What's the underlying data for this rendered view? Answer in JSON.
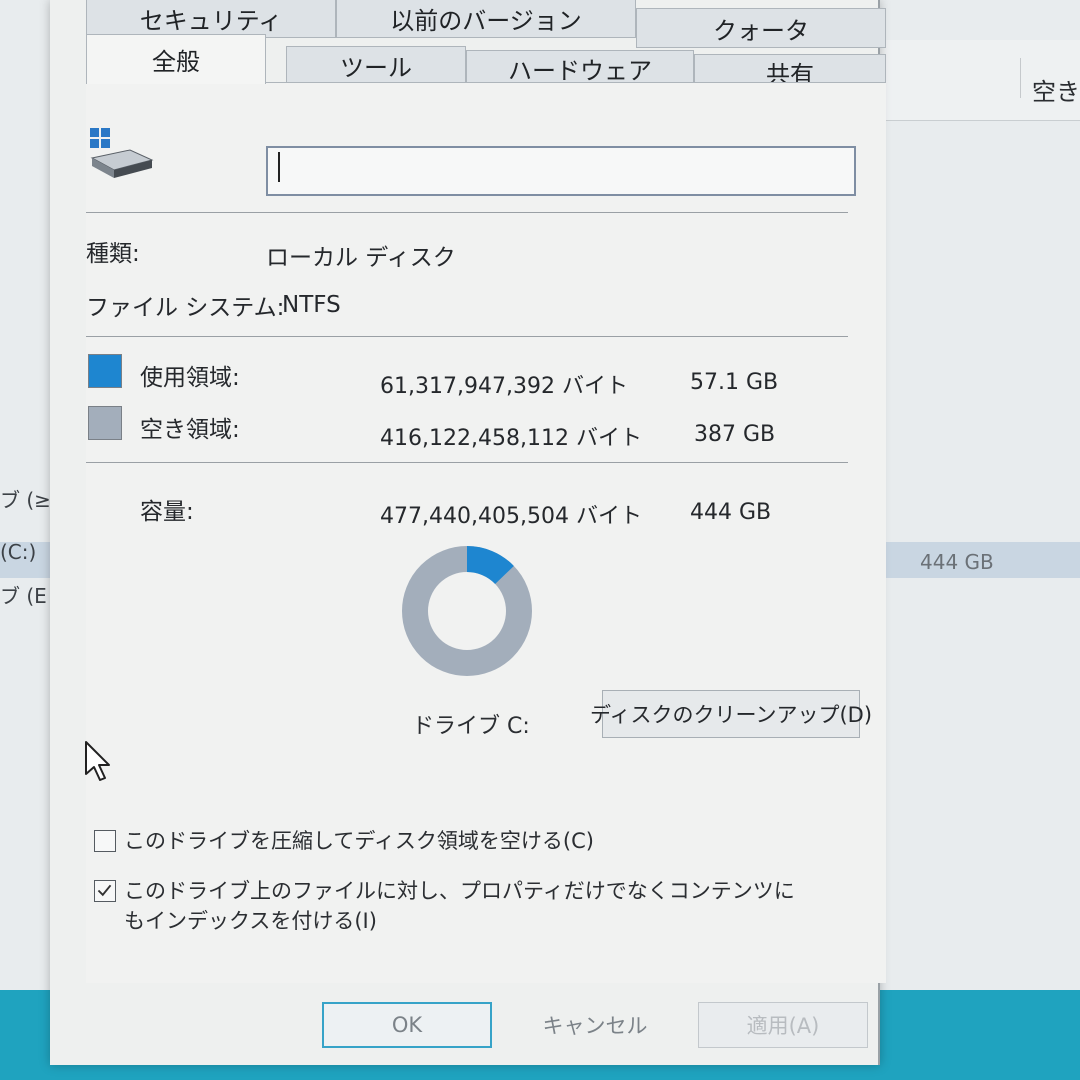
{
  "background": {
    "column_header": "空き領",
    "rows": [
      {
        "label": "ブ (≥"
      },
      {
        "label": "(C:)",
        "size": "444 GB"
      },
      {
        "label": "ブ (E"
      }
    ]
  },
  "tabs": {
    "row1": [
      "セキュリティ",
      "以前のバージョン",
      "クォータ"
    ],
    "row2": [
      "全般",
      "ツール",
      "ハードウェア",
      "共有"
    ],
    "active": "全般"
  },
  "general": {
    "name_value": "",
    "type_label": "種類:",
    "type_value": "ローカル ディスク",
    "fs_label": "ファイル システム:",
    "fs_value": "NTFS",
    "used_label": "使用領域:",
    "used_bytes": "61,317,947,392 バイト",
    "used_gb": "57.1 GB",
    "free_label": "空き領域:",
    "free_bytes": "416,122,458,112 バイト",
    "free_gb": "387 GB",
    "capacity_label": "容量:",
    "capacity_bytes": "477,440,405,504 バイト",
    "capacity_gb": "444 GB",
    "drive_caption": "ドライブ C:",
    "cleanup_button": "ディスクのクリーンアップ(D)",
    "used_fraction": 0.128,
    "used_color": "#1e86d0",
    "free_color": "#a3aebb",
    "compress_label": "このドライブを圧縮してディスク領域を空ける(C)",
    "compress_checked": false,
    "index_label": "このドライブ上のファイルに対し、プロパティだけでなくコンテンツにもインデックスを付ける(I)",
    "index_checked": true
  },
  "footer": {
    "ok": "OK",
    "cancel": "キャンセル",
    "apply": "適用(A)"
  }
}
